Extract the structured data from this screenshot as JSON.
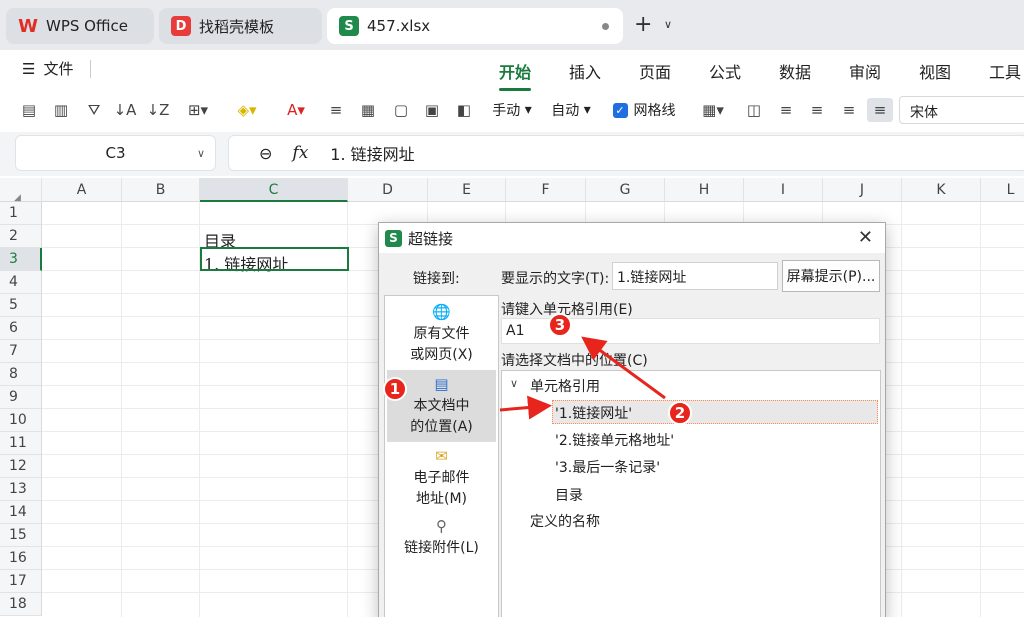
{
  "tabs": [
    {
      "label": "WPS Office"
    },
    {
      "label": "找稻壳模板"
    },
    {
      "label": "457.xlsx"
    }
  ],
  "ribbon": {
    "file_label": "文件",
    "tabs": [
      "开始",
      "插入",
      "页面",
      "公式",
      "数据",
      "审阅",
      "视图",
      "工具"
    ],
    "active_tab": "开始"
  },
  "toolbar": {
    "manual_label": "手动",
    "auto_label": "自动",
    "gridlines_label": "网格线",
    "gridlines_checked": true,
    "font_name": "宋体"
  },
  "formula_bar": {
    "name_box": "C3",
    "fx_label": "fx",
    "formula": "1. 链接网址"
  },
  "sheet": {
    "columns": [
      "A",
      "B",
      "C",
      "D",
      "E",
      "F",
      "G",
      "H",
      "I",
      "J",
      "K",
      "L"
    ],
    "rows": [
      "1",
      "2",
      "3",
      "4",
      "5",
      "6",
      "7",
      "8",
      "9",
      "10",
      "11",
      "12",
      "13",
      "14",
      "15",
      "16",
      "17",
      "18"
    ],
    "cells": {
      "C2": "目录",
      "C3": "1. 链接网址"
    },
    "selected_cell": "C3"
  },
  "dialog": {
    "title": "超链接",
    "link_to_label": "链接到:",
    "display_text_label": "要显示的文字(T):",
    "display_text_value": "1.链接网址",
    "screen_tip_button": "屏幕提示(P)...",
    "link_types": [
      {
        "label_line1": "原有文件",
        "label_line2": "或网页(X)",
        "icon": "globe-file-icon"
      },
      {
        "label_line1": "本文档中",
        "label_line2": "的位置(A)",
        "icon": "document-place-icon",
        "selected": true
      },
      {
        "label_line1": "电子邮件",
        "label_line2": "地址(M)",
        "icon": "email-icon"
      },
      {
        "label_line1": "链接附件(L)",
        "label_line2": "",
        "icon": "paperclip-icon"
      }
    ],
    "cell_ref_label": "请键入单元格引用(E)",
    "cell_ref_value": "A1",
    "place_label": "请选择文档中的位置(C)",
    "tree": {
      "group_label": "单元格引用",
      "items": [
        "'1.链接网址'",
        "'2.链接单元格地址'",
        "'3.最后一条记录'",
        "目录"
      ],
      "selected_index": 0,
      "defined_names_label": "定义的名称"
    }
  },
  "annotations": [
    "1",
    "2",
    "3"
  ],
  "colors": {
    "accent_green": "#1d7a3e",
    "annotation_red": "#e7251d"
  }
}
